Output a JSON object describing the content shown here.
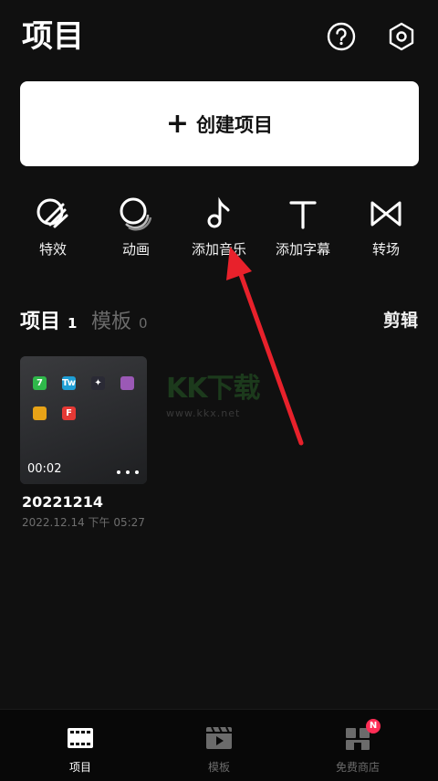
{
  "header": {
    "title": "项目"
  },
  "create": {
    "plus": "+",
    "label": "创建项目"
  },
  "tools": [
    {
      "label": "特效",
      "icon": "effects-icon"
    },
    {
      "label": "动画",
      "icon": "animation-icon"
    },
    {
      "label": "添加音乐",
      "icon": "music-note-icon"
    },
    {
      "label": "添加字幕",
      "icon": "text-icon"
    },
    {
      "label": "转场",
      "icon": "transition-icon"
    }
  ],
  "tabs": {
    "projects": {
      "label": "项目",
      "count": "1"
    },
    "templates": {
      "label": "模板",
      "count": "0"
    },
    "edit_label": "剪辑"
  },
  "project": {
    "duration": "00:02",
    "name": "20221214",
    "date": "2022.12.14 下午 05:27",
    "thumbnail_apps": [
      {
        "color": "#2fb84a",
        "text": "7"
      },
      {
        "color": "#1e9fd6",
        "text": "Tw"
      },
      {
        "color": "#2a2a35",
        "text": "✦"
      },
      {
        "color": "#9b59b6",
        "text": ""
      },
      {
        "color": "#e8a317",
        "text": ""
      },
      {
        "color": "#e53935",
        "text": "F"
      }
    ]
  },
  "watermark": {
    "logo": "KK下载",
    "url": "www.kkx.net"
  },
  "bottom_nav": [
    {
      "label": "项目",
      "icon": "film-strip-icon",
      "active": true
    },
    {
      "label": "模板",
      "icon": "template-play-icon",
      "active": false
    },
    {
      "label": "免费商店",
      "icon": "store-icon",
      "active": false,
      "badge": "N"
    }
  ],
  "colors": {
    "background": "#101010",
    "accent_badge": "#ff2d55",
    "arrow": "#e8212b",
    "inactive_text": "#6b6b6b"
  }
}
